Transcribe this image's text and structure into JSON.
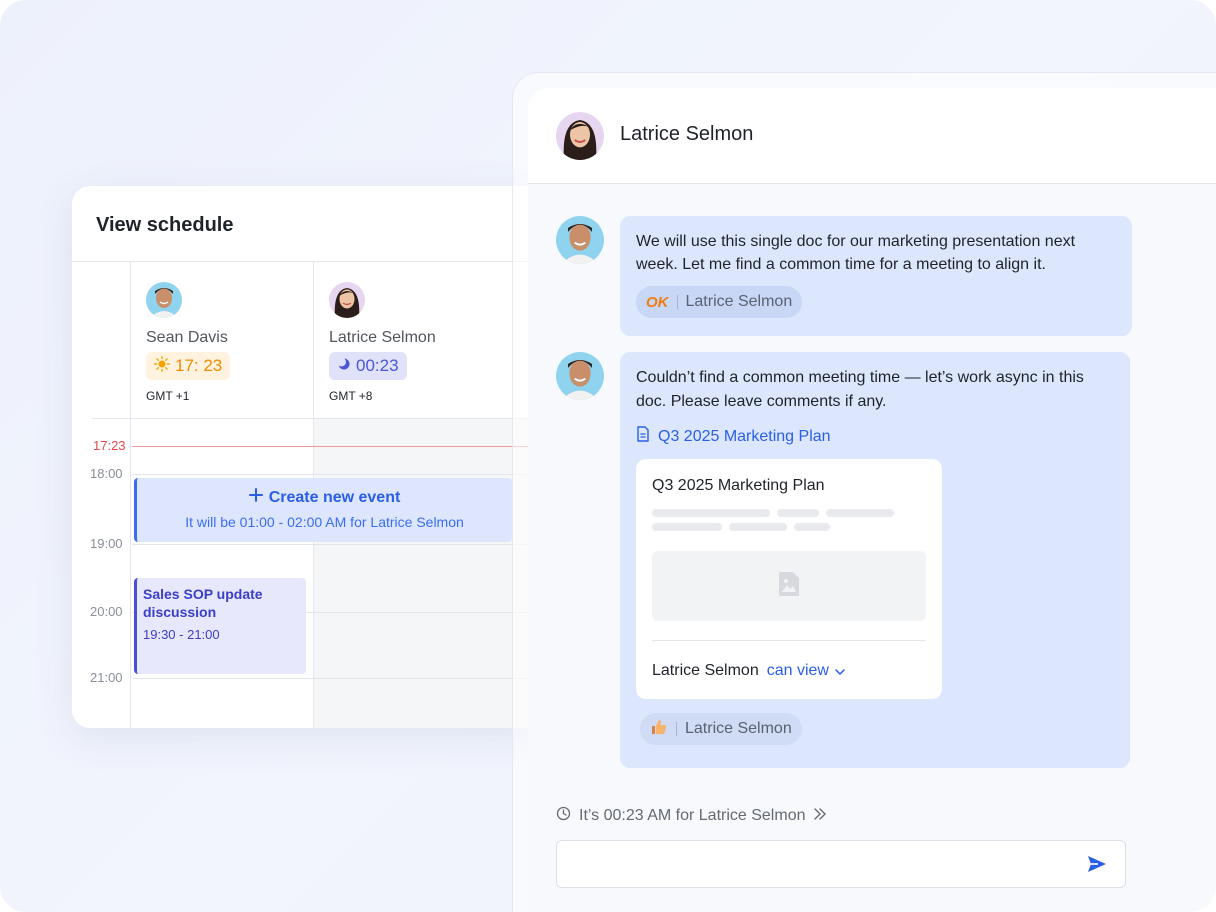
{
  "schedule": {
    "title": "View schedule",
    "people": [
      {
        "name": "Sean Davis",
        "time": "17: 23",
        "time_icon": "sun-icon",
        "gmt": "GMT +1"
      },
      {
        "name": "Latrice Selmon",
        "time": "00:23",
        "time_icon": "moon-icon",
        "gmt": "GMT +8"
      }
    ],
    "current_time": "17:23",
    "hours": [
      "18:00",
      "19:00",
      "20:00",
      "21:00"
    ],
    "create_event": {
      "title": "Create new event",
      "subtitle": "It will be 01:00 - 02:00 AM for Latrice Selmon"
    },
    "event": {
      "title": "Sales SOP update discussion",
      "time": "19:30 - 21:00"
    }
  },
  "chat": {
    "title": "Latrice Selmon",
    "messages": [
      {
        "text": "We will use this single doc for our marketing presentation next week. Let me find a common time for a meeting to align it.",
        "reaction": {
          "emoji": "OK",
          "user": "Latrice Selmon"
        }
      },
      {
        "text": "Couldn’t find a common meeting time — let’s work async in this doc. Please leave comments if any.",
        "doc_link": "Q3 2025 Marketing Plan",
        "doc_card": {
          "title": "Q3 2025 Marketing Plan",
          "permission_user": "Latrice Selmon",
          "permission_level": "can view"
        },
        "reaction": {
          "emoji": "thumbs-up-icon",
          "user": "Latrice Selmon"
        }
      }
    ],
    "timezone_note": "It’s 00:23 AM for Latrice Selmon",
    "input_placeholder": ""
  },
  "colors": {
    "accent": "#2a5ee8",
    "bubble": "#dce7fd",
    "now_line": "#e5484d",
    "sun_badge": "#f08c00",
    "moon_badge": "#4b55d8"
  }
}
